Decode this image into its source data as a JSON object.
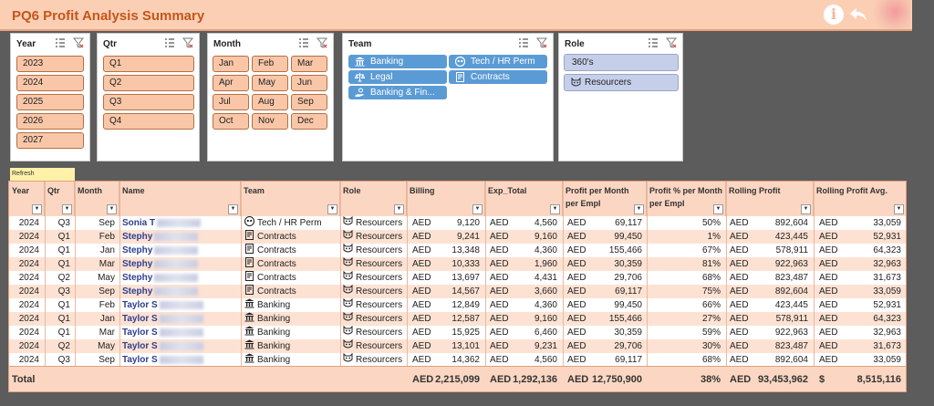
{
  "title": "PQ6 Profit Analysis Summary",
  "slicers": {
    "year": {
      "label": "Year",
      "items": [
        "2023",
        "2024",
        "2025",
        "2026",
        "2027"
      ]
    },
    "qtr": {
      "label": "Qtr",
      "items": [
        "Q1",
        "Q2",
        "Q3",
        "Q4"
      ]
    },
    "month": {
      "label": "Month",
      "items": [
        "Jan",
        "Feb",
        "Mar",
        "Apr",
        "May",
        "Jun",
        "Jul",
        "Aug",
        "Sep",
        "Oct",
        "Nov",
        "Dec"
      ]
    },
    "team": {
      "label": "Team",
      "items": [
        "Banking",
        "Tech / HR Perm",
        "Legal",
        "Contracts",
        "Banking & Fin..."
      ]
    },
    "role": {
      "label": "Role",
      "items": [
        "360's",
        "Resourcers"
      ]
    }
  },
  "refresh_label": "Refresh",
  "table": {
    "headers": [
      "Year",
      "Qtr",
      "Month",
      "Name",
      "Team",
      "Role",
      "Billing",
      "Exp_Total",
      "Profit per Month per Empl",
      "Profit % per Month per Empl",
      "Rolling Profit",
      "Rolling Profit Avg."
    ],
    "currency": "AED",
    "rows": [
      [
        "2024",
        "Q3",
        "Sep",
        "Sonia T",
        "Tech / HR Perm",
        "Resourcers",
        "9,120",
        "4,560",
        "69,117",
        "50%",
        "892,604",
        "33,059"
      ],
      [
        "2024",
        "Q1",
        "Feb",
        "Stephy",
        "Contracts",
        "Resourcers",
        "9,241",
        "9,160",
        "99,450",
        "1%",
        "423,445",
        "52,931"
      ],
      [
        "2024",
        "Q1",
        "Jan",
        "Stephy",
        "Contracts",
        "Resourcers",
        "13,348",
        "4,360",
        "155,466",
        "67%",
        "578,911",
        "64,323"
      ],
      [
        "2024",
        "Q1",
        "Mar",
        "Stephy",
        "Contracts",
        "Resourcers",
        "10,333",
        "1,960",
        "30,359",
        "81%",
        "922,963",
        "32,963"
      ],
      [
        "2024",
        "Q2",
        "May",
        "Stephy",
        "Contracts",
        "Resourcers",
        "13,697",
        "4,431",
        "29,706",
        "68%",
        "823,487",
        "31,673"
      ],
      [
        "2024",
        "Q3",
        "Sep",
        "Stephy",
        "Contracts",
        "Resourcers",
        "14,567",
        "3,660",
        "69,117",
        "75%",
        "892,604",
        "33,059"
      ],
      [
        "2024",
        "Q1",
        "Feb",
        "Taylor S",
        "Banking",
        "Resourcers",
        "12,849",
        "4,360",
        "99,450",
        "66%",
        "423,445",
        "52,931"
      ],
      [
        "2024",
        "Q1",
        "Jan",
        "Taylor S",
        "Banking",
        "Resourcers",
        "12,587",
        "9,160",
        "155,466",
        "27%",
        "578,911",
        "64,323"
      ],
      [
        "2024",
        "Q1",
        "Mar",
        "Taylor S",
        "Banking",
        "Resourcers",
        "15,925",
        "6,460",
        "30,359",
        "59%",
        "922,963",
        "32,963"
      ],
      [
        "2024",
        "Q2",
        "May",
        "Taylor S",
        "Banking",
        "Resourcers",
        "13,101",
        "9,231",
        "29,706",
        "30%",
        "823,487",
        "31,673"
      ],
      [
        "2024",
        "Q3",
        "Sep",
        "Taylor S",
        "Banking",
        "Resourcers",
        "14,362",
        "4,560",
        "69,117",
        "68%",
        "892,604",
        "33,059"
      ]
    ],
    "total": {
      "label": "Total",
      "billing": "2,215,099",
      "exp_total": "1,292,136",
      "profit": "12,750,900",
      "profit_pct": "38%",
      "rolling": "93,453,962",
      "rolling_avg_currency": "$",
      "rolling_avg": "8,515,116"
    }
  }
}
